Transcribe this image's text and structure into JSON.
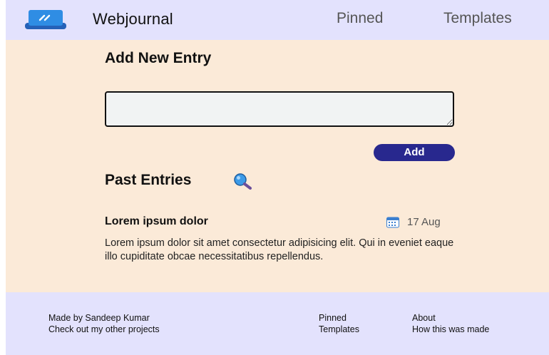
{
  "header": {
    "brand": "Webjournal",
    "nav": {
      "pinned": "Pinned",
      "templates": "Templates"
    },
    "logo_icon": "notebook-pencil-icon",
    "colors": {
      "logo_top": "#2f8de4",
      "logo_bottom": "#2561b8"
    }
  },
  "main": {
    "add_heading": "Add New Entry",
    "entry_input": {
      "value": "",
      "placeholder": ""
    },
    "add_button": "Add",
    "past_heading": "Past Entries",
    "past_icon": "magnifying-glass-icon",
    "entries": [
      {
        "title": "Lorem ipsum dolor",
        "date_icon": "calendar-icon",
        "date": "17 Aug",
        "body": "Lorem ipsum dolor sit amet consectetur adipisicing elit. Qui in eveniet eaque illo cupiditate obcae necessitatibus repellendus."
      }
    ],
    "colors": {
      "background": "#fbead8",
      "button": "#28288e"
    }
  },
  "footer": {
    "made_by": "Made by Sandeep Kumar",
    "other_projects": "Check out my other projects",
    "pinned": "Pinned",
    "templates": "Templates",
    "about": "About",
    "how_made": "How this was made",
    "colors": {
      "background": "#e3e2fd"
    }
  }
}
